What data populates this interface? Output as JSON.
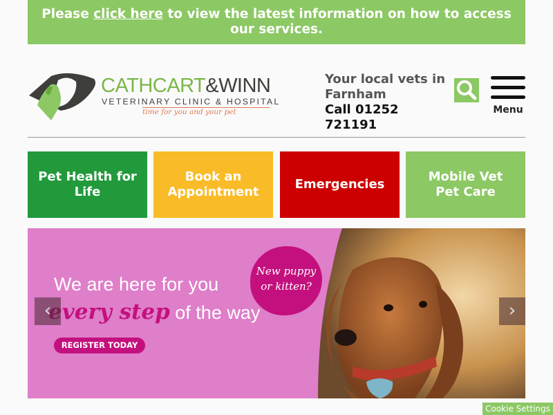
{
  "notice": {
    "before": "Please ",
    "link": "click here",
    "after": " to view the latest information on how to access our services."
  },
  "logo": {
    "brand_green": "CATHCART",
    "brand_amp": "&",
    "brand_dark": "WINN",
    "subtitle": "VETERINARY CLINIC & HOSPITAL",
    "tagline": "time for you and your pet"
  },
  "header": {
    "local": "Your local vets in Farnham",
    "phone": "Call 01252 721191",
    "menu_label": "Menu",
    "search_icon": "search-icon"
  },
  "tiles": [
    {
      "label": "Pet Health for Life",
      "color": "#229a3c"
    },
    {
      "label": "Book an Appointment",
      "color": "#f9bc28"
    },
    {
      "label": "Emergencies",
      "color": "#cc0000"
    },
    {
      "label": "Mobile Vet Pet Care",
      "color": "#8cc864"
    }
  ],
  "banner": {
    "line1": "We are here for you",
    "script": "every step",
    "line2_rest": " of the way",
    "button": "REGISTER TODAY",
    "badge_line1": "New puppy",
    "badge_line2": "or kitten?",
    "prev": "‹",
    "next": "›"
  },
  "colors": {
    "accent_green": "#8cc864",
    "brand_magenta": "#c4107e",
    "banner_pink": "#df7ec9"
  },
  "cookie": "Cookie Settings"
}
